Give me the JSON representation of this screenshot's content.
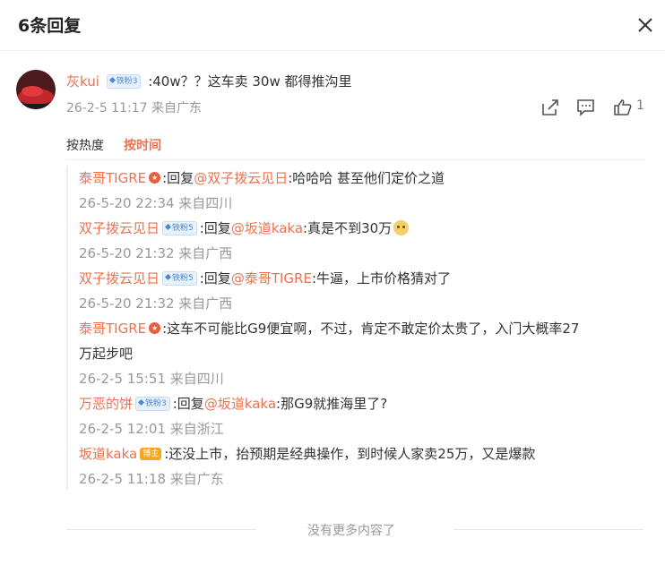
{
  "header": {
    "title": "6条回复",
    "close_icon": "close-icon"
  },
  "main_comment": {
    "user": "灰kui",
    "badge": "铁粉3",
    "text": ":40w？？这车卖 30w 都得推沟里",
    "meta": "26-2-5 11:17 来自广东",
    "like_count": "1",
    "icons": [
      "share-icon",
      "comment-icon",
      "like-icon"
    ]
  },
  "sort": {
    "hot": "按热度",
    "time": "按时间"
  },
  "replies": [
    {
      "user": "泰哥TIGRE",
      "badge": "",
      "reply_label": ":回复",
      "reply_to": "@双子拨云见日",
      "text": ":哈哈哈 甚至他们定价之道",
      "time": "26-5-20 22:34 来自四川"
    },
    {
      "user": "双子拨云见日",
      "badge": "铁粉5",
      "reply_label": ":回复",
      "reply_to": "@坂道kaka",
      "text": ":真是不到30万",
      "time": "26-5-20 21:32 来自广西"
    },
    {
      "user": "双子拨云见日",
      "badge": "铁粉5",
      "reply_label": ":回复",
      "reply_to": "@泰哥TIGRE",
      "text": ":牛逼，上市价格猜对了",
      "time": "26-5-20 21:32 来自广西"
    },
    {
      "user": "泰哥TIGRE",
      "badge": "",
      "text_line1": ":这车不可能比G9便宜啊，不过，肯定不敢定价太贵了，入门大概率27",
      "text_line2": "万起步吧",
      "time": "26-2-5 15:51 来自四川"
    },
    {
      "user": "万恶的饼",
      "badge": "铁粉3",
      "reply_label": ":回复",
      "reply_to": "@坂道kaka",
      "text": ":那G9就推海里了?",
      "time": "26-2-5 12:01 来自浙江"
    },
    {
      "user": "坂道kaka",
      "badge": "博主",
      "text": ":还没上市，抬预期是经典操作，到时候人家卖25万，又是爆款",
      "time": "26-2-5 11:18 来自广东"
    }
  ],
  "footer": {
    "text": "没有更多内容了"
  },
  "colors": {
    "accent": "#eb7350",
    "meta": "#999999",
    "fan_badge": "#4a8ad8",
    "blogger_badge": "#f5a623"
  }
}
